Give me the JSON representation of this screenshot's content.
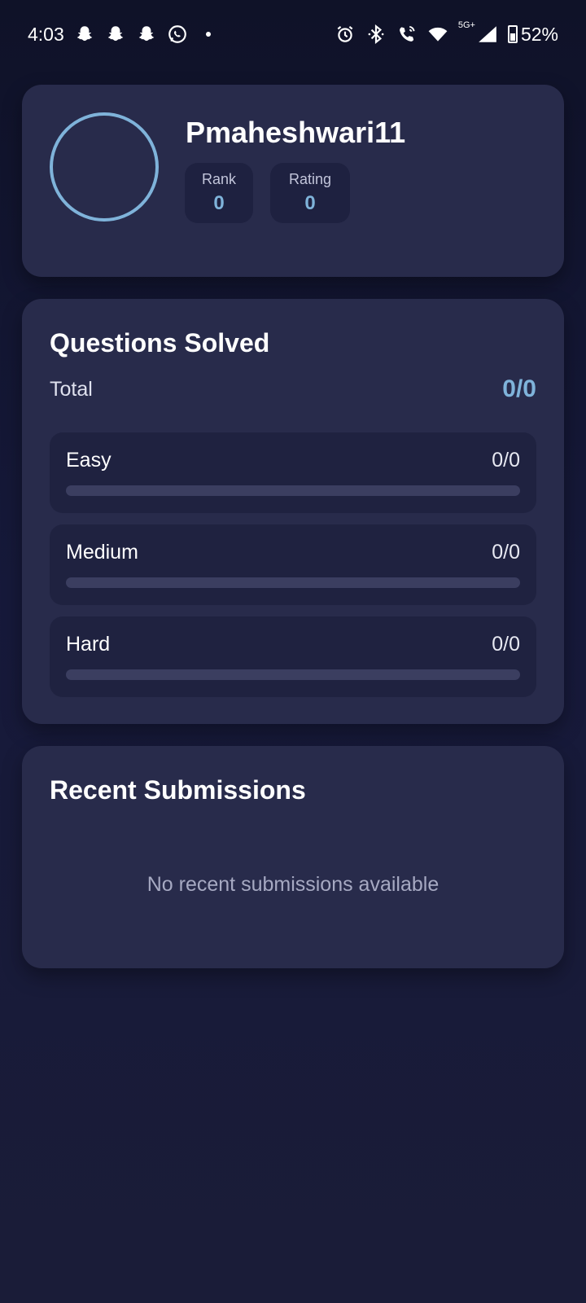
{
  "status_bar": {
    "time": "4:03",
    "battery": "52%",
    "network": "5G+",
    "left_icons": [
      "snapchat-icon",
      "snapchat-icon",
      "snapchat-icon",
      "whatsapp-icon"
    ],
    "right_icons": [
      "alarm-icon",
      "bluetooth-icon",
      "wifi-calling-icon",
      "wifi-icon",
      "signal-icon",
      "battery-icon"
    ]
  },
  "profile": {
    "username": "Pmaheshwari11",
    "rank_label": "Rank",
    "rank_value": "0",
    "rating_label": "Rating",
    "rating_value": "0"
  },
  "questions_solved": {
    "title": "Questions Solved",
    "total_label": "Total",
    "total_value": "0/0",
    "levels": [
      {
        "label": "Easy",
        "count": "0/0",
        "progress": 0
      },
      {
        "label": "Medium",
        "count": "0/0",
        "progress": 0
      },
      {
        "label": "Hard",
        "count": "0/0",
        "progress": 0
      }
    ]
  },
  "recent_submissions": {
    "title": "Recent Submissions",
    "empty_text": "No recent submissions available"
  },
  "colors": {
    "background": "#141733",
    "card": "#282b4b",
    "accent": "#7fb3da",
    "track": "#3b3e60"
  }
}
